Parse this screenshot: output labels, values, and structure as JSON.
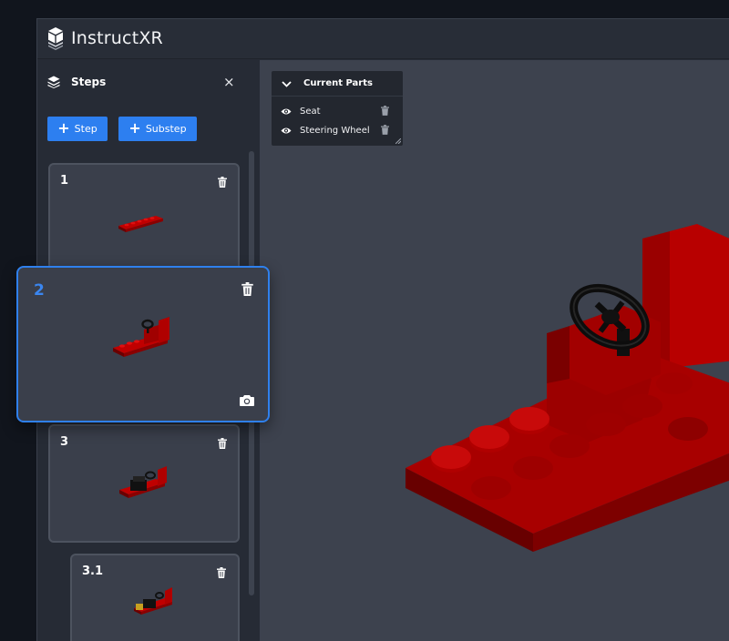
{
  "app": {
    "title": "InstructXR"
  },
  "sidebar": {
    "title": "Steps",
    "close_label": "×",
    "add_step_label": "Step",
    "add_substep_label": "Substep"
  },
  "steps": [
    {
      "number": "1"
    },
    {
      "number": "2"
    },
    {
      "number": "3"
    },
    {
      "number": "3.1"
    }
  ],
  "current_parts": {
    "title": "Current Parts",
    "items": [
      "Seat",
      "Steering Wheel"
    ]
  },
  "colors": {
    "accent": "#2d7ff0",
    "brick_red": "#a00000",
    "steering_black": "#111111",
    "background": "#11151d",
    "panel": "#262b35",
    "viewport": "#3d424e"
  }
}
